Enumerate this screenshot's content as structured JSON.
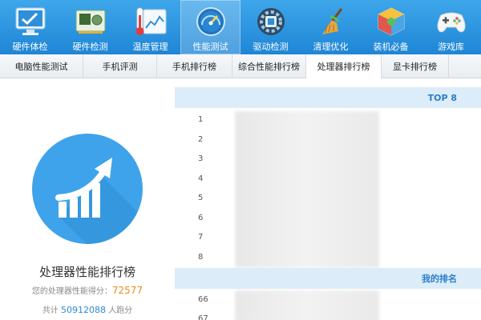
{
  "toolbar": {
    "items": [
      {
        "label": "硬件体检",
        "icon": "monitor-check-icon",
        "active": false
      },
      {
        "label": "硬件检测",
        "icon": "graphics-card-icon",
        "active": false
      },
      {
        "label": "温度管理",
        "icon": "thermometer-chart-icon",
        "active": false
      },
      {
        "label": "性能测试",
        "icon": "speedometer-icon",
        "active": true
      },
      {
        "label": "驱动检测",
        "icon": "gear-chip-icon",
        "active": false
      },
      {
        "label": "清理优化",
        "icon": "broom-icon",
        "active": false
      },
      {
        "label": "装机必备",
        "icon": "cube-box-icon",
        "active": false
      },
      {
        "label": "游戏库",
        "icon": "gamepad-icon",
        "active": false
      }
    ]
  },
  "tabs": [
    {
      "label": "电脑性能测试",
      "active": false
    },
    {
      "label": "手机评测",
      "active": false
    },
    {
      "label": "手机排行榜",
      "active": false
    },
    {
      "label": "综合性能排行榜",
      "active": false
    },
    {
      "label": "处理器排行榜",
      "active": true
    },
    {
      "label": "显卡排行榜",
      "active": false
    }
  ],
  "left_panel": {
    "icon": "rising-bar-chart-icon",
    "title": "处理器性能排行榜",
    "score_prefix": "您的处理器性能得分：",
    "score_value": "72577",
    "count_prefix": "共计",
    "count_value": "50912088",
    "count_suffix": "人跑分"
  },
  "ranking": {
    "top_header": "TOP 8",
    "top_ranks": [
      "1",
      "2",
      "3",
      "4",
      "5",
      "6",
      "7",
      "8"
    ],
    "my_header": "我的排名",
    "my_ranks": [
      "66",
      "67"
    ]
  },
  "colors": {
    "toolbar_bg": "#2b93de",
    "accent_blue": "#3ea3ea",
    "score_orange": "#f08a1c",
    "header_bg": "#dcecf9"
  }
}
